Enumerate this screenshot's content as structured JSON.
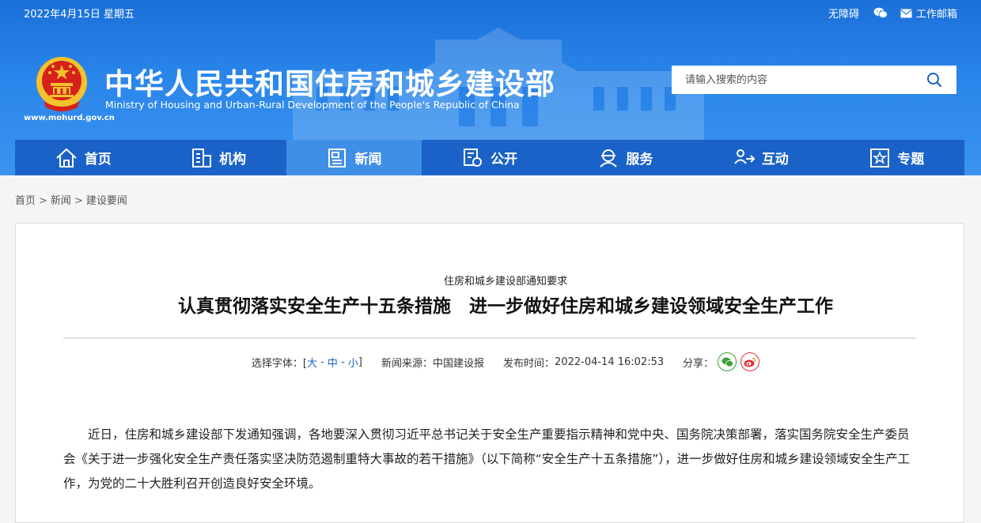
{
  "topbar": {
    "date": "2022年4月15日 星期五",
    "accessibility": "无障碍",
    "wechat_icon": "wechat-icon",
    "mail_icon": "mail-icon",
    "work_mail": "工作邮箱"
  },
  "brand": {
    "title_cn": "中华人民共和国住房和城乡建设部",
    "title_en": "Ministry of Housing and Urban-Rural Development of the People's Republic of China",
    "url": "www.mohurd.gov.cn",
    "emblem": "national-emblem",
    "colors": {
      "primary": "#1a62c8",
      "header_bg": "#2a86ea",
      "emblem_red": "#d6201c",
      "gold": "#f4c22b"
    }
  },
  "search": {
    "placeholder": "请输入搜索的内容",
    "icon": "search-icon"
  },
  "nav": {
    "items": [
      {
        "label": "首页",
        "icon": "home-icon"
      },
      {
        "label": "机构",
        "icon": "building-icon"
      },
      {
        "label": "新闻",
        "icon": "news-icon",
        "active": true
      },
      {
        "label": "公开",
        "icon": "document-icon"
      },
      {
        "label": "服务",
        "icon": "service-icon"
      },
      {
        "label": "互动",
        "icon": "interact-icon"
      },
      {
        "label": "专题",
        "icon": "star-icon"
      }
    ]
  },
  "breadcrumb": {
    "items": [
      "首页",
      "新闻",
      "建设要闻"
    ],
    "separator": ">"
  },
  "article": {
    "subtitle": "住房和城乡建设部通知要求",
    "title": "认真贯彻落实安全生产十五条措施　进一步做好住房和城乡建设领域安全生产工作",
    "font_size_label": "选择字体：[",
    "font_size_options": [
      "大",
      "中",
      "小"
    ],
    "font_size_close": "]",
    "source_label": "新闻来源：",
    "source": "中国建设报",
    "time_label": "发布时间：",
    "time": "2022-04-14 16:02:53",
    "share_label": "分享：",
    "share_icons": [
      "wechat-share-icon",
      "weibo-share-icon"
    ],
    "body": "近日，住房和城乡建设部下发通知强调，各地要深入贯彻习近平总书记关于安全生产重要指示精神和党中央、国务院决策部署，落实国务院安全生产委员会《关于进一步强化安全生产责任落实坚决防范遏制重特大事故的若干措施》（以下简称“安全生产十五条措施”），进一步做好住房和城乡建设领域安全生产工作，为党的二十大胜利召开创造良好安全环境。"
  }
}
